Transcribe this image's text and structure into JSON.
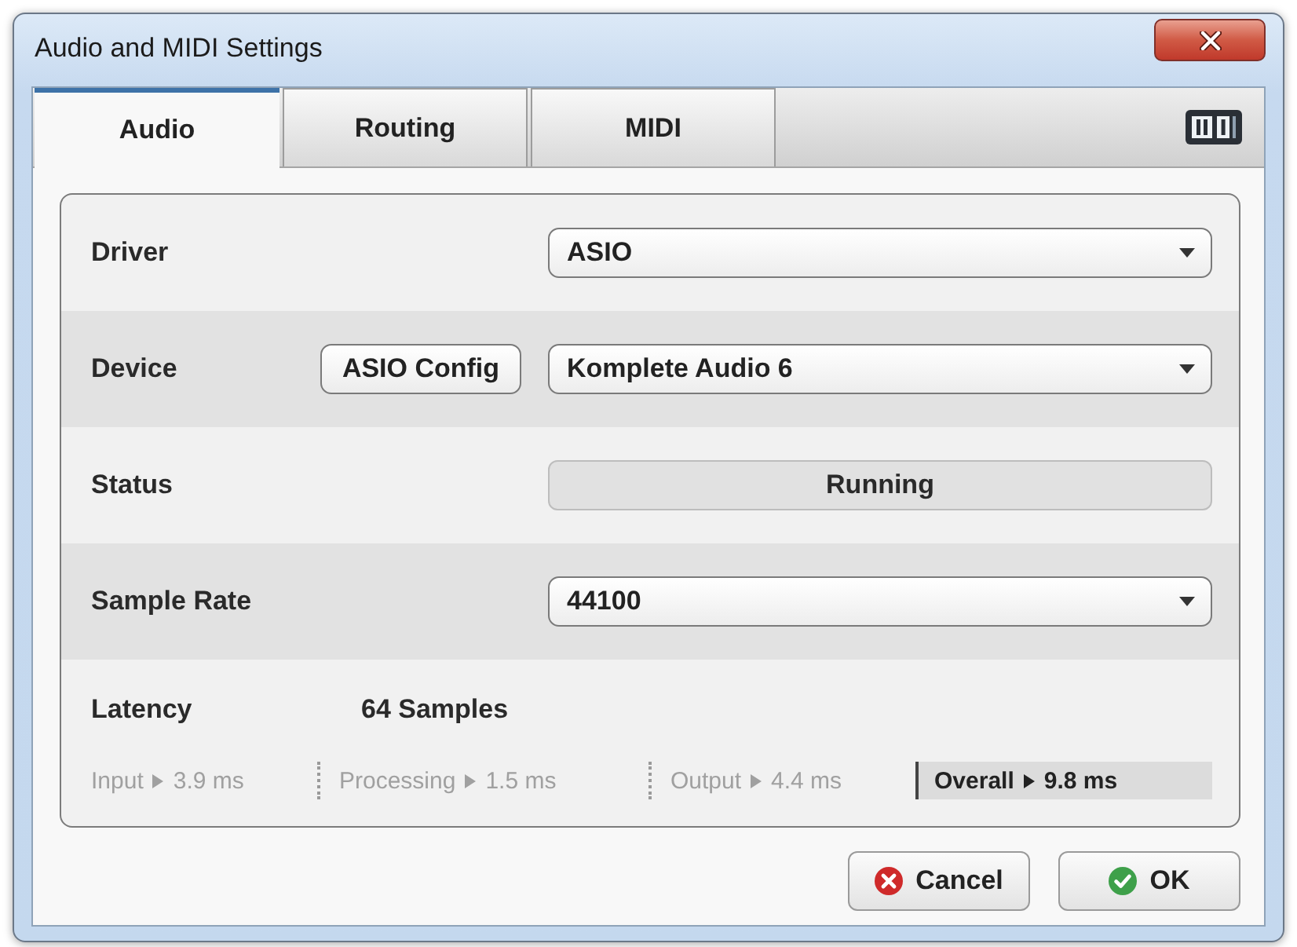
{
  "window": {
    "title": "Audio and MIDI Settings"
  },
  "tabs": [
    {
      "label": "Audio",
      "selected": true
    },
    {
      "label": "Routing",
      "selected": false
    },
    {
      "label": "MIDI",
      "selected": false
    }
  ],
  "settings": [
    {
      "label": "Driver",
      "kind": "dropdown",
      "value": "ASIO"
    },
    {
      "label": "Device",
      "kind": "dropdown",
      "button": "ASIO Config",
      "value": "Komplete Audio 6"
    },
    {
      "label": "Status",
      "kind": "status",
      "value": "Running"
    },
    {
      "label": "Sample Rate",
      "kind": "dropdown",
      "value": "44100"
    }
  ],
  "latency": {
    "label": "Latency",
    "value": "64 Samples",
    "breakdown": [
      {
        "label": "Input",
        "value": "3.9 ms",
        "emphasized": false
      },
      {
        "label": "Processing",
        "value": "1.5 ms",
        "emphasized": false
      },
      {
        "label": "Output",
        "value": "4.4 ms",
        "emphasized": false
      },
      {
        "label": "Overall",
        "value": "9.8 ms",
        "emphasized": true
      }
    ]
  },
  "buttons": [
    {
      "label": "Cancel",
      "kind": "cancel"
    },
    {
      "label": "OK",
      "kind": "ok"
    }
  ]
}
